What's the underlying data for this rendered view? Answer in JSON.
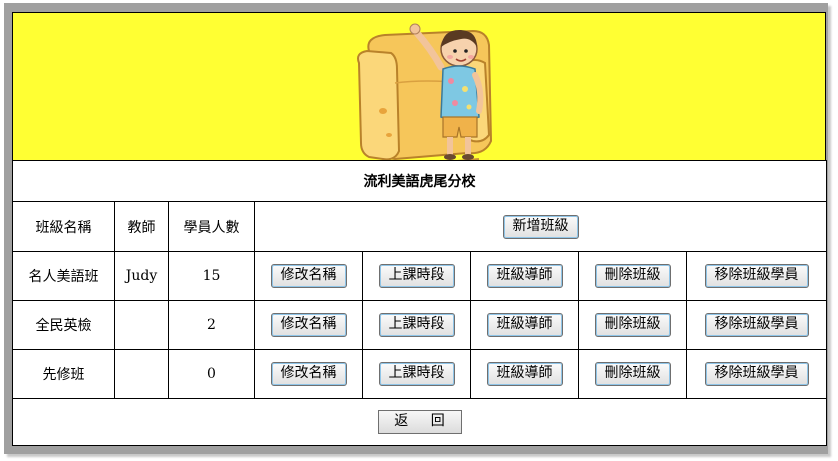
{
  "banner": {
    "image": "child-on-sofa-illustration"
  },
  "school_name": "流利美語虎尾分校",
  "table": {
    "headers": {
      "class_name": "班級名稱",
      "teacher": "教師",
      "student_count": "學員人數"
    },
    "add_class_label": "新增班級",
    "action_labels": {
      "rename": "修改名稱",
      "schedule": "上課時段",
      "homeroom": "班級導師",
      "delete": "刪除班級",
      "remove_students": "移除班級學員"
    },
    "rows": [
      {
        "class_name": "名人美語班",
        "teacher": "Judy",
        "student_count": "15"
      },
      {
        "class_name": "全民英檢",
        "teacher": "",
        "student_count": "2"
      },
      {
        "class_name": "先修班",
        "teacher": "",
        "student_count": "0"
      }
    ]
  },
  "back_label": "返 回",
  "colors": {
    "banner_bg": "#ffff33",
    "frame": "#a0a0a0",
    "button_border": "#8fc5e8"
  }
}
